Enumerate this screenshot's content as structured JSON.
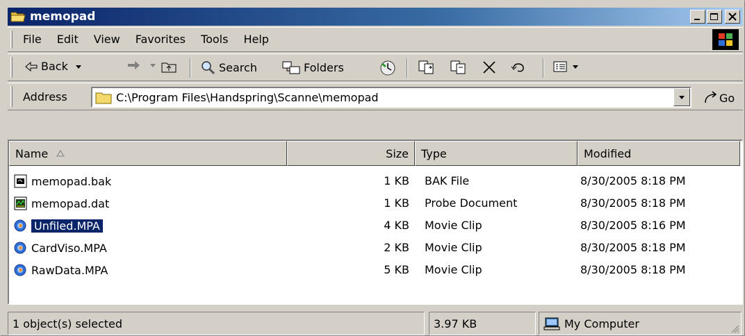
{
  "window": {
    "title": "memopad"
  },
  "menu": [
    "File",
    "Edit",
    "View",
    "Favorites",
    "Tools",
    "Help"
  ],
  "toolbar": {
    "back": "Back",
    "search": "Search",
    "folders": "Folders"
  },
  "address": {
    "label": "Address",
    "value": "C:\\Program Files\\Handspring\\Scanne\\memopad",
    "go": "Go"
  },
  "columns": {
    "name": "Name",
    "size": "Size",
    "type": "Type",
    "modified": "Modified"
  },
  "files": [
    {
      "name": "memopad.bak",
      "size": "1 KB",
      "type": "BAK File",
      "modified": "8/30/2005 8:18 PM",
      "icon": "bak-file-icon",
      "selected": false
    },
    {
      "name": "memopad.dat",
      "size": "1 KB",
      "type": "Probe Document",
      "modified": "8/30/2005 8:18 PM",
      "icon": "probe-doc-icon",
      "selected": false
    },
    {
      "name": "Unfiled.MPA",
      "size": "4 KB",
      "type": "Movie Clip",
      "modified": "8/30/2005 8:16 PM",
      "icon": "movie-clip-icon",
      "selected": true
    },
    {
      "name": "CardViso.MPA",
      "size": "2 KB",
      "type": "Movie Clip",
      "modified": "8/30/2005 8:18 PM",
      "icon": "movie-clip-icon",
      "selected": false
    },
    {
      "name": "RawData.MPA",
      "size": "5 KB",
      "type": "Movie Clip",
      "modified": "8/30/2005 8:18 PM",
      "icon": "movie-clip-icon",
      "selected": false
    }
  ],
  "status": {
    "selection": "1 object(s) selected",
    "size": "3.97 KB",
    "location": "My Computer"
  },
  "colors": {
    "titlebar": "#0a246a",
    "selection": "#0a246a",
    "face": "#d4d0c8"
  }
}
